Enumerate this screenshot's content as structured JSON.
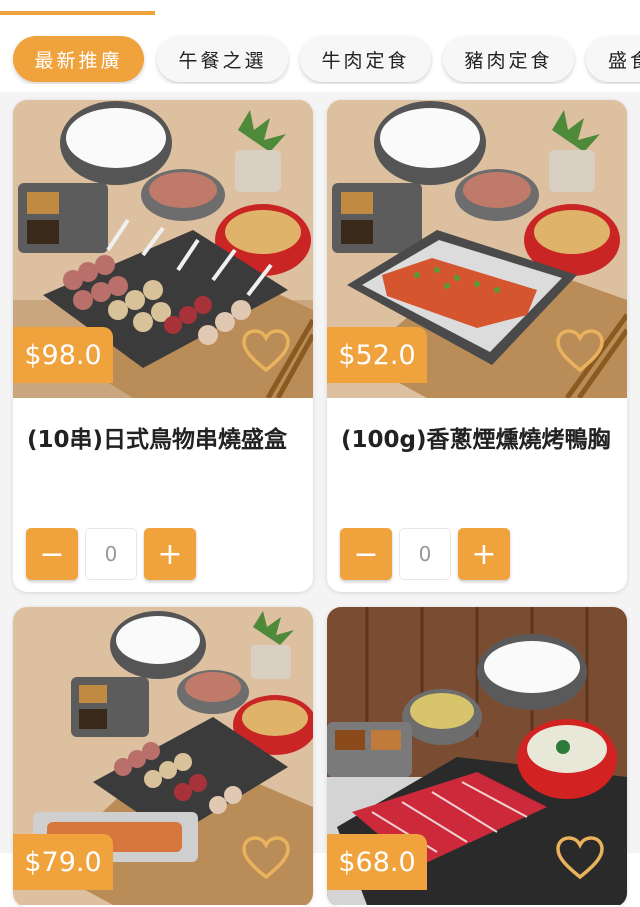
{
  "categories": [
    {
      "label": "最新推廣",
      "active": true
    },
    {
      "label": "午餐之選",
      "active": false
    },
    {
      "label": "牛肉定食",
      "active": false
    },
    {
      "label": "豬肉定食",
      "active": false
    },
    {
      "label": "盛食",
      "active": false
    }
  ],
  "products": [
    {
      "price": "$98.0",
      "name": "(10串)日式鳥物串燒盛盒",
      "qty_minus": "−",
      "qty_value": "0",
      "qty_plus": "+",
      "icon": "heart-outline-icon"
    },
    {
      "price": "$52.0",
      "name": "(100g)香蔥煙燻燒烤鴨胸",
      "qty_minus": "−",
      "qty_value": "0",
      "qty_plus": "+",
      "icon": "heart-outline-icon"
    },
    {
      "price": "$79.0",
      "name": "",
      "icon": "heart-outline-icon"
    },
    {
      "price": "$68.0",
      "name": "",
      "icon": "heart-outline-icon"
    }
  ],
  "colors": {
    "accent": "#f0a23c",
    "background": "#f4f4f4",
    "card": "#ffffff"
  }
}
